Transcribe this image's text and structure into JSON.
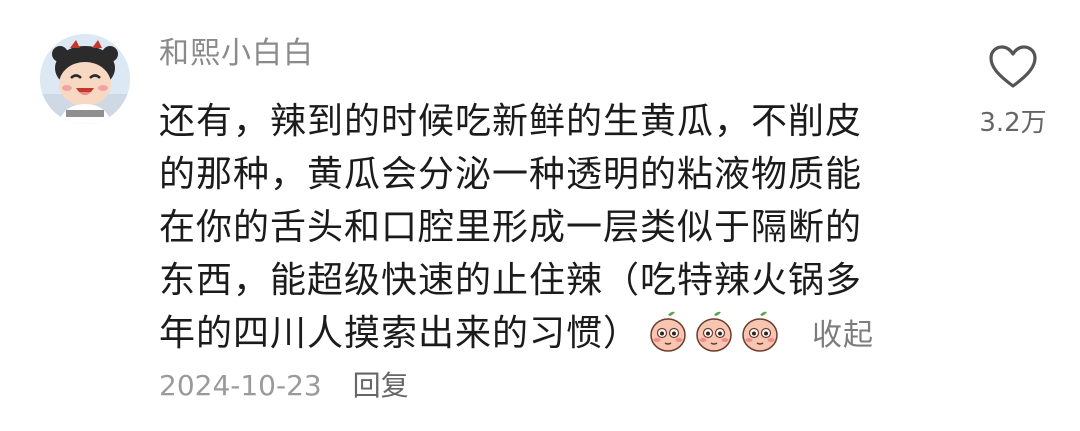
{
  "comment": {
    "username": "和熙小白白",
    "lines": [
      "还有，辣到的时候吃新鲜的生黄瓜，不削皮",
      "的那种，黄瓜会分泌一种透明的粘液物质能",
      "在你的舌头和口腔里形成一层类似于隔断的",
      "东西，能超级快速的止住辣（吃特辣火锅多",
      "年的四川人摸索出来的习惯）"
    ],
    "emojis": [
      "shy-peach-emoji",
      "shy-peach-emoji",
      "shy-peach-emoji"
    ],
    "collapse_label": "收起",
    "date": "2024-10-23",
    "reply_label": "回复",
    "like_count": "3.2万"
  },
  "colors": {
    "username": "#8a8a8a",
    "text": "#1b1b1b",
    "meta": "#9a9a9a"
  }
}
